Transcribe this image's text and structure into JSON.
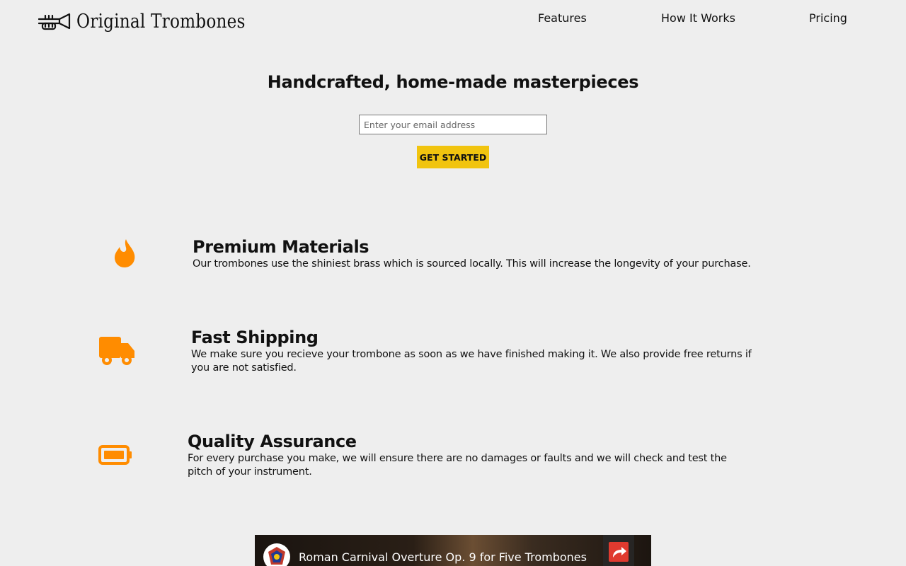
{
  "header": {
    "logo_text": "Original Trombones",
    "nav": {
      "features": "Features",
      "how_it_works": "How It Works",
      "pricing": "Pricing"
    }
  },
  "hero": {
    "title": "Handcrafted, home-made masterpieces",
    "email_placeholder": "Enter your email address",
    "email_value": "",
    "cta_label": "GET STARTED"
  },
  "features": [
    {
      "icon": "fire-icon",
      "title": "Premium Materials",
      "description": "Our trombones use the shiniest brass which is sourced locally. This will increase the longevity of your purchase."
    },
    {
      "icon": "truck-icon",
      "title": "Fast Shipping",
      "description": "We make sure you recieve your trombone as soon as we have finished making it. We also provide free returns if you are not satisfied."
    },
    {
      "icon": "battery-icon",
      "title": "Quality Assurance",
      "description": "For every purchase you make, we will ensure there are no damages or faults and we will check and test the pitch of your instrument."
    }
  ],
  "video": {
    "title": "Roman Carnival Overture Op. 9 for Five Trombones",
    "share_icon": "share-icon",
    "channel_icon": "channel-logo-icon"
  },
  "colors": {
    "accent": "#f1c40f",
    "icon_orange": "#ff8c00",
    "background": "#eeeeee"
  }
}
